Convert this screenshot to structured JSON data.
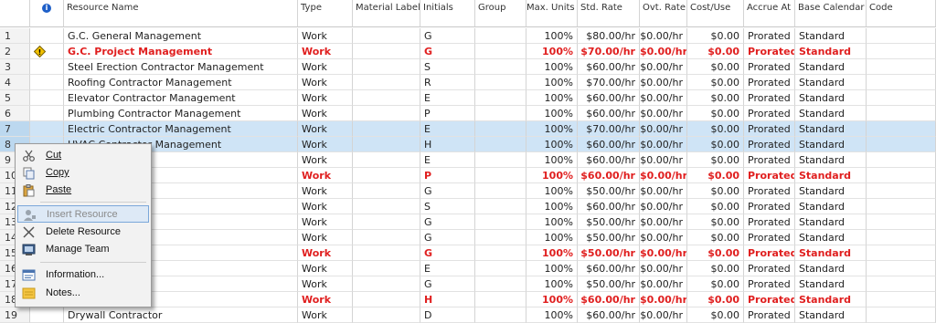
{
  "columns": {
    "id": "",
    "indicator_icon": "info-icon",
    "name": "Resource Name",
    "type": "Type",
    "material_label": "Material Label",
    "initials": "Initials",
    "group": "Group",
    "max_units": "Max. Units",
    "std_rate": "Std. Rate",
    "ovt_rate": "Ovt. Rate",
    "cost_use": "Cost/Use",
    "accrue_at": "Accrue At",
    "base_calendar": "Base Calendar",
    "code": "Code"
  },
  "rows": [
    {
      "id": "1",
      "name": "G.C. General Management",
      "type": "Work",
      "initials": "G",
      "max_units": "100%",
      "std_rate": "$80.00/hr",
      "ovt_rate": "$0.00/hr",
      "cost_use": "$0.00",
      "accrue_at": "Prorated",
      "base_calendar": "Standard"
    },
    {
      "id": "2",
      "name": "G.C. Project Management",
      "type": "Work",
      "initials": "G",
      "max_units": "100%",
      "std_rate": "$70.00/hr",
      "ovt_rate": "$0.00/hr",
      "cost_use": "$0.00",
      "accrue_at": "Prorated",
      "base_calendar": "Standard"
    },
    {
      "id": "3",
      "name": "Steel Erection Contractor Management",
      "type": "Work",
      "initials": "S",
      "max_units": "100%",
      "std_rate": "$60.00/hr",
      "ovt_rate": "$0.00/hr",
      "cost_use": "$0.00",
      "accrue_at": "Prorated",
      "base_calendar": "Standard"
    },
    {
      "id": "4",
      "name": "Roofing Contractor Management",
      "type": "Work",
      "initials": "R",
      "max_units": "100%",
      "std_rate": "$70.00/hr",
      "ovt_rate": "$0.00/hr",
      "cost_use": "$0.00",
      "accrue_at": "Prorated",
      "base_calendar": "Standard"
    },
    {
      "id": "5",
      "name": "Elevator Contractor Management",
      "type": "Work",
      "initials": "E",
      "max_units": "100%",
      "std_rate": "$60.00/hr",
      "ovt_rate": "$0.00/hr",
      "cost_use": "$0.00",
      "accrue_at": "Prorated",
      "base_calendar": "Standard"
    },
    {
      "id": "6",
      "name": "Plumbing Contractor Management",
      "type": "Work",
      "initials": "P",
      "max_units": "100%",
      "std_rate": "$60.00/hr",
      "ovt_rate": "$0.00/hr",
      "cost_use": "$0.00",
      "accrue_at": "Prorated",
      "base_calendar": "Standard"
    },
    {
      "id": "7",
      "name": "Electric Contractor Management",
      "type": "Work",
      "initials": "E",
      "max_units": "100%",
      "std_rate": "$70.00/hr",
      "ovt_rate": "$0.00/hr",
      "cost_use": "$0.00",
      "accrue_at": "Prorated",
      "base_calendar": "Standard"
    },
    {
      "id": "8",
      "name": "HVAC Contractor Management",
      "type": "Work",
      "initials": "H",
      "max_units": "100%",
      "std_rate": "$60.00/hr",
      "ovt_rate": "$0.00/hr",
      "cost_use": "$0.00",
      "accrue_at": "Prorated",
      "base_calendar": "Standard"
    },
    {
      "id": "9",
      "name": "or",
      "type": "Work",
      "initials": "E",
      "max_units": "100%",
      "std_rate": "$60.00/hr",
      "ovt_rate": "$0.00/hr",
      "cost_use": "$0.00",
      "accrue_at": "Prorated",
      "base_calendar": "Standard"
    },
    {
      "id": "10",
      "name": "actor",
      "type": "Work",
      "initials": "P",
      "max_units": "100%",
      "std_rate": "$60.00/hr",
      "ovt_rate": "$0.00/hr",
      "cost_use": "$0.00",
      "accrue_at": "Prorated",
      "base_calendar": "Standard"
    },
    {
      "id": "11",
      "name": "w",
      "type": "Work",
      "initials": "G",
      "max_units": "100%",
      "std_rate": "$50.00/hr",
      "ovt_rate": "$0.00/hr",
      "cost_use": "$0.00",
      "accrue_at": "Prorated",
      "base_calendar": "Standard"
    },
    {
      "id": "12",
      "name": "ntractor",
      "type": "Work",
      "initials": "S",
      "max_units": "100%",
      "std_rate": "$60.00/hr",
      "ovt_rate": "$0.00/hr",
      "cost_use": "$0.00",
      "accrue_at": "Prorated",
      "base_calendar": "Standard"
    },
    {
      "id": "13",
      "name": "enter Crew",
      "type": "Work",
      "initials": "G",
      "max_units": "100%",
      "std_rate": "$50.00/hr",
      "ovt_rate": "$0.00/hr",
      "cost_use": "$0.00",
      "accrue_at": "Prorated",
      "base_calendar": "Standard"
    },
    {
      "id": "14",
      "name": "ew",
      "type": "Work",
      "initials": "G",
      "max_units": "100%",
      "std_rate": "$50.00/hr",
      "ovt_rate": "$0.00/hr",
      "cost_use": "$0.00",
      "accrue_at": "Prorated",
      "base_calendar": "Standard"
    },
    {
      "id": "15",
      "name": "",
      "type": "Work",
      "initials": "G",
      "max_units": "100%",
      "std_rate": "$50.00/hr",
      "ovt_rate": "$0.00/hr",
      "cost_use": "$0.00",
      "accrue_at": "Prorated",
      "base_calendar": "Standard"
    },
    {
      "id": "16",
      "name": "tor",
      "type": "Work",
      "initials": "E",
      "max_units": "100%",
      "std_rate": "$60.00/hr",
      "ovt_rate": "$0.00/hr",
      "cost_use": "$0.00",
      "accrue_at": "Prorated",
      "base_calendar": "Standard"
    },
    {
      "id": "17",
      "name": "enter Crew",
      "type": "Work",
      "initials": "G",
      "max_units": "100%",
      "std_rate": "$50.00/hr",
      "ovt_rate": "$0.00/hr",
      "cost_use": "$0.00",
      "accrue_at": "Prorated",
      "base_calendar": "Standard"
    },
    {
      "id": "18",
      "name": "",
      "type": "Work",
      "initials": "H",
      "max_units": "100%",
      "std_rate": "$60.00/hr",
      "ovt_rate": "$0.00/hr",
      "cost_use": "$0.00",
      "accrue_at": "Prorated",
      "base_calendar": "Standard"
    },
    {
      "id": "19",
      "name": "Drywall Contractor",
      "type": "Work",
      "initials": "D",
      "max_units": "100%",
      "std_rate": "$60.00/hr",
      "ovt_rate": "$0.00/hr",
      "cost_use": "$0.00",
      "accrue_at": "Prorated",
      "base_calendar": "Standard"
    }
  ],
  "overallocated_rows": [
    "2",
    "10",
    "15",
    "18"
  ],
  "selected_rows": [
    "7",
    "8"
  ],
  "warning_indicator": {
    "row": "2",
    "icon": "warning-diamond-icon"
  },
  "context_menu": {
    "items": [
      {
        "label": "Cut",
        "icon": "scissors-icon"
      },
      {
        "label": "Copy",
        "icon": "copy-icon"
      },
      {
        "label": "Paste",
        "icon": "paste-icon"
      },
      {
        "label": "Insert Resource",
        "icon": "insert-resource-icon",
        "highlighted": true,
        "disabled": true
      },
      {
        "label": "Delete Resource",
        "icon": "delete-x-icon"
      },
      {
        "label": "Manage Team",
        "icon": "manage-team-icon"
      },
      {
        "label": "Information...",
        "icon": "information-form-icon"
      },
      {
        "label": "Notes...",
        "icon": "notes-icon"
      }
    ]
  },
  "colors": {
    "overallocated_text": "#e01f1f",
    "selection_bg": "#cfe4f6",
    "menu_highlight": "#dde9f6",
    "info_icon": "#1e5fc8",
    "warning_icon": "#f2c200"
  }
}
